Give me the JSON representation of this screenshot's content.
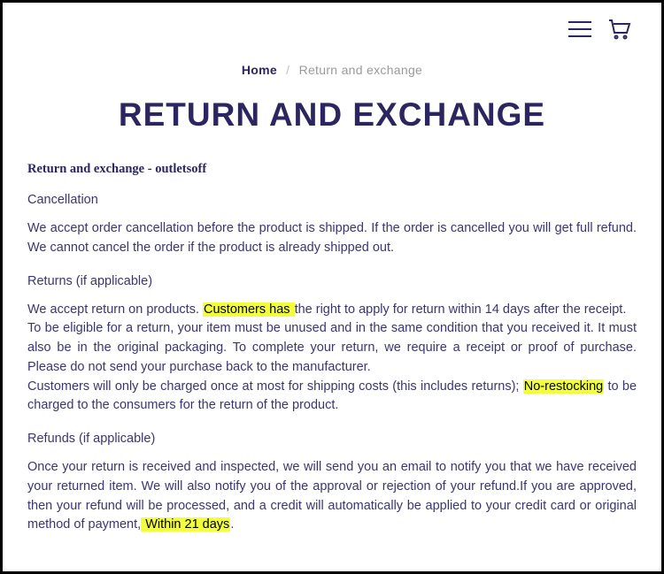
{
  "breadcrumb": {
    "home": "Home",
    "sep": "/",
    "current": "Return and exchange"
  },
  "title": "RETURN AND EXCHANGE",
  "subtitle": "Return and exchange - outletsoff",
  "cancellation": {
    "head": "Cancellation",
    "body": "We accept order cancellation before the product is shipped. If the order is cancelled you will get full refund. We cannot cancel the order if the product is already shipped out."
  },
  "returns": {
    "head": "Returns (if applicable)",
    "p1a": "We accept return on products. ",
    "p1_hl": "Customers  has ",
    "p1b": "the right to apply for return within 14 days after the receipt.",
    "p2": "To be eligible for a return, your item must be unused and in the same condition that you received it. It must also be in the original packaging. To complete your return, we require a receipt or proof of purchase. Please do not send your purchase back to the manufacturer.",
    "p3a": "Customers will only be charged once at most for shipping costs (this includes returns); ",
    "p3_hl": "No-restocking",
    "p3b": " to be charged to the consumers for the return of the product."
  },
  "refunds": {
    "head": "Refunds (if applicable)",
    "p1a": "Once your return is received and inspected, we will send you an email to notify you that we have received your returned item. We will also notify you of the approval or rejection of your refund.If you are approved, then your refund will be processed, and a credit will automatically be applied to your credit card or original method of payment,",
    "p1_hl": " Within 21 days",
    "p1b": "."
  }
}
